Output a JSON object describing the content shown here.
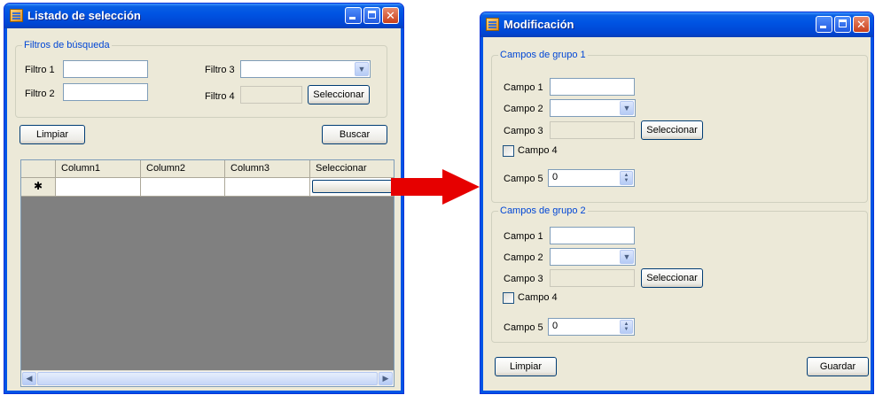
{
  "left_window": {
    "title": "Listado de selección",
    "filters_group_title": "Filtros de búsqueda",
    "filtro1_label": "Filtro 1",
    "filtro2_label": "Filtro 2",
    "filtro3_label": "Filtro 3",
    "filtro4_label": "Filtro 4",
    "filtro1_value": "",
    "filtro2_value": "",
    "filtro4_value": "",
    "seleccionar_label": "Seleccionar",
    "limpiar_label": "Limpiar",
    "buscar_label": "Buscar",
    "grid": {
      "columns": [
        "Column1",
        "Column2",
        "Column3",
        "Seleccionar"
      ],
      "new_row_marker": "✱"
    }
  },
  "right_window": {
    "title": "Modificación",
    "groups": [
      {
        "title": "Campos de grupo 1",
        "campo1_label": "Campo 1",
        "campo2_label": "Campo 2",
        "campo3_label": "Campo 3",
        "campo4_label": "Campo 4",
        "campo5_label": "Campo 5",
        "campo5_value": "0",
        "seleccionar_label": "Seleccionar"
      },
      {
        "title": "Campos de grupo 2",
        "campo1_label": "Campo 1",
        "campo2_label": "Campo 2",
        "campo3_label": "Campo 3",
        "campo4_label": "Campo 4",
        "campo5_label": "Campo 5",
        "campo5_value": "0",
        "seleccionar_label": "Seleccionar"
      }
    ],
    "limpiar_label": "Limpiar",
    "guardar_label": "Guardar"
  },
  "colors": {
    "titlebar_blue": "#0054e3",
    "window_face": "#ece9d8",
    "group_title": "#0046d5",
    "arrow_red": "#e60000",
    "grid_background": "#808080"
  }
}
